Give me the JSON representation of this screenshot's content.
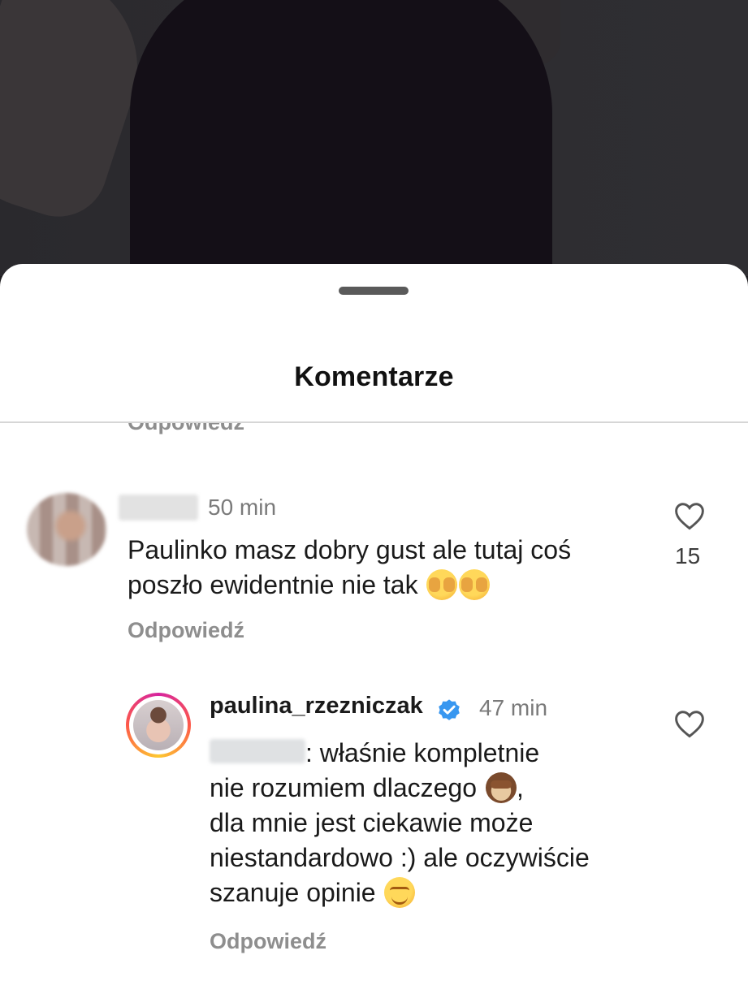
{
  "sheet": {
    "title": "Komentarze"
  },
  "comments": {
    "clipped_reply_label": "Odpowiedź",
    "first": {
      "time": "50 min",
      "text_line1": "Paulinko masz dobry gust ale tutaj coś",
      "text_line2": "poszło ewidentnie nie tak",
      "reply_label": "Odpowiedź",
      "like_count": "15",
      "emojis": [
        "face-peeking-icon",
        "face-peeking-icon"
      ]
    },
    "second": {
      "username": "paulina_rzezniczak",
      "verified": true,
      "time": "47 min",
      "text_line1": ": właśnie kompletnie",
      "text_line2": "nie rozumiem dlaczego",
      "text_line2_tail": ",",
      "text_line3": "dla mnie jest ciekawie może",
      "text_line4": "niestandardowo :) ale oczywiście",
      "text_line5": "szanuje opinie",
      "reply_label": "Odpowiedź",
      "emojis": [
        "see-no-evil-monkey-icon",
        "smiling-face-icon"
      ]
    }
  },
  "colors": {
    "verified": "#3897f0",
    "secondary_text": "#8e8e8e",
    "avatar_ring": "#d6249f"
  }
}
